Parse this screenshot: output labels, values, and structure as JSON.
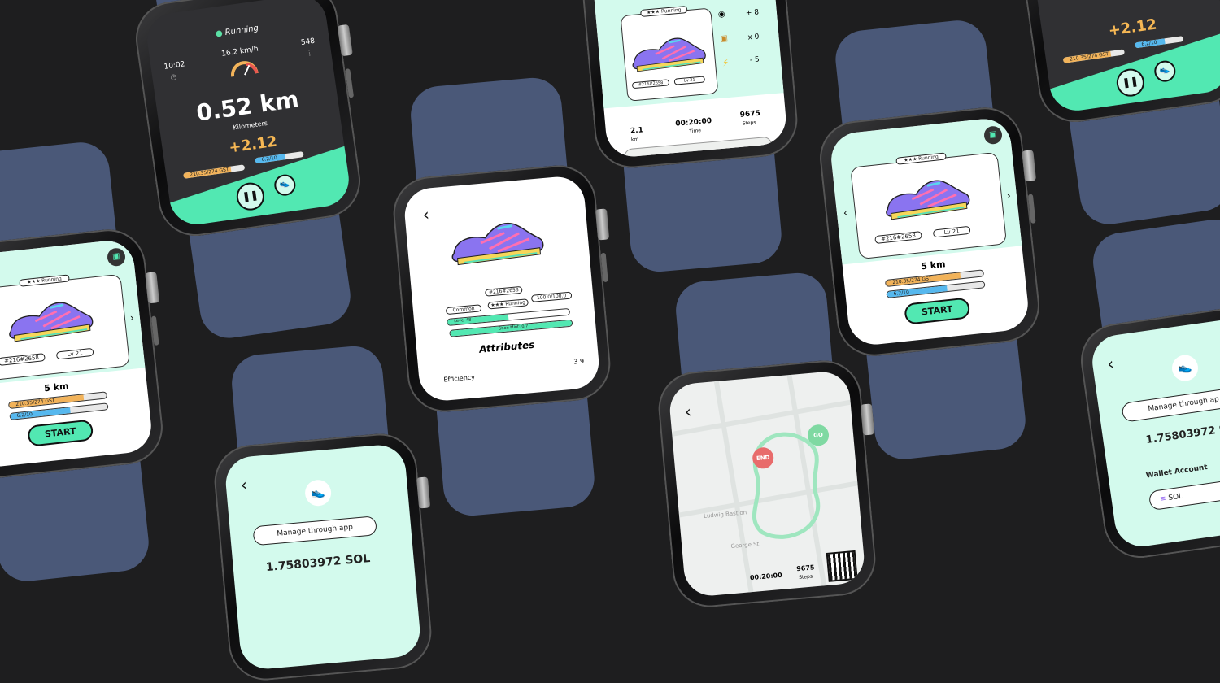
{
  "running": {
    "status": "Running",
    "time": "10:02",
    "speed": "16.2 km/h",
    "steps": "548",
    "distance": "0.52 km",
    "distance_label": "Kilometers",
    "earned": "+2.12",
    "gst_bar_label": "210.35/274 GST",
    "energy_bar_label": "6.2/10",
    "gst_fill": 0.77,
    "energy_fill": 0.62
  },
  "home": {
    "type_badge": "★★★ Running",
    "sneaker_id": "#216#2658",
    "level": "Lv 21",
    "goal": "5 km",
    "gst_bar_label": "210.35/274 GST",
    "energy_bar_label": "6.2/10",
    "gst_fill": 0.77,
    "energy_fill": 0.62,
    "start_label": "START"
  },
  "detail": {
    "sneaker_id": "#216#2658",
    "rarity": "Common",
    "type": "★★★ Running",
    "durability": "100.0/100.0",
    "level_bar": "Level 48",
    "mint_bar": "Shoe Mint: 0/7",
    "attributes_title": "Attributes",
    "efficiency_label": "Efficiency",
    "efficiency_value": "3.9"
  },
  "summary": {
    "type_badge": "★★★ Running",
    "sneaker_id": "#216#2658",
    "level": "Lv 21",
    "gst_reward": "+ 8",
    "box_reward": "x 0",
    "energy_cost": "- 5",
    "distance": "2.1",
    "distance_unit": "km",
    "time": "00:20:00",
    "time_label": "Time",
    "steps": "9675",
    "steps_label": "Steps"
  },
  "wallet": {
    "manage_label": "Manage through app",
    "balance": "1.75803972 SOL",
    "balance_partial": "1.75803972 S",
    "manage_partial": "Manage through ap",
    "wallet_account_label": "Wallet Account",
    "sol_label": "SOL"
  },
  "map": {
    "end_label": "END",
    "go_label": "GO",
    "time": "00:20:00",
    "steps": "9675",
    "steps_label": "Steps",
    "street1": "Ludwig Bastion",
    "street2": "George St"
  },
  "colors": {
    "mint": "#d3faed",
    "accent_green": "#52e8b2",
    "gold_bar": "#f2b35a",
    "blue_bar": "#56b8ee",
    "earned_gold": "#f5b754",
    "band": "#4a5878",
    "background": "#1e1e1f"
  }
}
